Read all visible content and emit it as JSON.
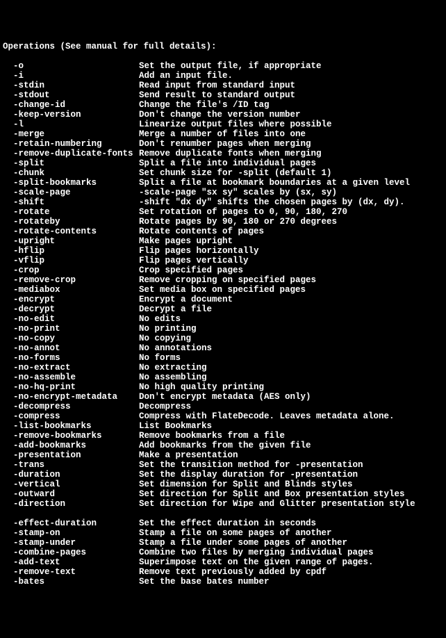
{
  "header": "Operations (See manual for full details):",
  "indent": "  ",
  "ops": [
    {
      "flag": "-o",
      "desc": "Set the output file, if appropriate"
    },
    {
      "flag": "-i",
      "desc": "Add an input file."
    },
    {
      "flag": "-stdin",
      "desc": "Read input from standard input"
    },
    {
      "flag": "-stdout",
      "desc": "Send result to standard output"
    },
    {
      "flag": "-change-id",
      "desc": "Change the file's /ID tag"
    },
    {
      "flag": "-keep-version",
      "desc": "Don't change the version number"
    },
    {
      "flag": "-l",
      "desc": "Linearize output files where possible"
    },
    {
      "flag": "-merge",
      "desc": "Merge a number of files into one"
    },
    {
      "flag": "-retain-numbering",
      "desc": "Don't renumber pages when merging"
    },
    {
      "flag": "-remove-duplicate-fonts",
      "desc": "Remove duplicate fonts when merging"
    },
    {
      "flag": "-split",
      "desc": "Split a file into individual pages"
    },
    {
      "flag": "-chunk",
      "desc": "Set chunk size for -split (default 1)"
    },
    {
      "flag": "-split-bookmarks",
      "desc": "Split a file at bookmark boundaries at a given level"
    },
    {
      "flag": "-scale-page",
      "desc": "-scale-page \"sx sy\" scales by (sx, sy)"
    },
    {
      "flag": "-shift",
      "desc": "-shift \"dx dy\" shifts the chosen pages by (dx, dy)."
    },
    {
      "flag": "-rotate",
      "desc": "Set rotation of pages to 0, 90, 180, 270"
    },
    {
      "flag": "-rotateby",
      "desc": "Rotate pages by 90, 180 or 270 degrees"
    },
    {
      "flag": "-rotate-contents",
      "desc": "Rotate contents of pages"
    },
    {
      "flag": "-upright",
      "desc": "Make pages upright"
    },
    {
      "flag": "-hflip",
      "desc": "Flip pages horizontally"
    },
    {
      "flag": "-vflip",
      "desc": "Flip pages vertically"
    },
    {
      "flag": "-crop",
      "desc": "Crop specified pages"
    },
    {
      "flag": "-remove-crop",
      "desc": "Remove cropping on specified pages"
    },
    {
      "flag": "-mediabox",
      "desc": "Set media box on specified pages"
    },
    {
      "flag": "-encrypt",
      "desc": "Encrypt a document"
    },
    {
      "flag": "-decrypt",
      "desc": "Decrypt a file"
    },
    {
      "flag": "-no-edit",
      "desc": "No edits"
    },
    {
      "flag": "-no-print",
      "desc": "No printing"
    },
    {
      "flag": "-no-copy",
      "desc": "No copying"
    },
    {
      "flag": "-no-annot",
      "desc": "No annotations"
    },
    {
      "flag": "-no-forms",
      "desc": "No forms"
    },
    {
      "flag": "-no-extract",
      "desc": "No extracting"
    },
    {
      "flag": "-no-assemble",
      "desc": "No assembling"
    },
    {
      "flag": "-no-hq-print",
      "desc": "No high quality printing"
    },
    {
      "flag": "-no-encrypt-metadata",
      "desc": "Don't encrypt metadata (AES only)"
    },
    {
      "flag": "-decompress",
      "desc": "Decompress"
    },
    {
      "flag": "-compress",
      "desc": "Compress with FlateDecode. Leaves metadata alone."
    },
    {
      "flag": "-list-bookmarks",
      "desc": "List Bookmarks"
    },
    {
      "flag": "-remove-bookmarks",
      "desc": "Remove bookmarks from a file"
    },
    {
      "flag": "-add-bookmarks",
      "desc": "Add bookmarks from the given file"
    },
    {
      "flag": "-presentation",
      "desc": "Make a presentation"
    },
    {
      "flag": "-trans",
      "desc": "Set the transition method for -presentation"
    },
    {
      "flag": "-duration",
      "desc": "Set the display duration for -presentation"
    },
    {
      "flag": "-vertical",
      "desc": "Set dimension for Split and Blinds styles"
    },
    {
      "flag": "-outward",
      "desc": "Set direction for Split and Box presentation styles"
    },
    {
      "flag": "-direction",
      "desc": "Set direction for Wipe and Glitter presentation style"
    },
    {
      "flag": "",
      "desc": ""
    },
    {
      "flag": "-effect-duration",
      "desc": "Set the effect duration in seconds"
    },
    {
      "flag": "-stamp-on",
      "desc": "Stamp a file on some pages of another"
    },
    {
      "flag": "-stamp-under",
      "desc": "Stamp a file under some pages of another"
    },
    {
      "flag": "-combine-pages",
      "desc": "Combine two files by merging individual pages"
    },
    {
      "flag": "-add-text",
      "desc": "Superimpose text on the given range of pages."
    },
    {
      "flag": "-remove-text",
      "desc": "Remove text previously added by cpdf"
    },
    {
      "flag": "-bates",
      "desc": "Set the base bates number"
    }
  ]
}
